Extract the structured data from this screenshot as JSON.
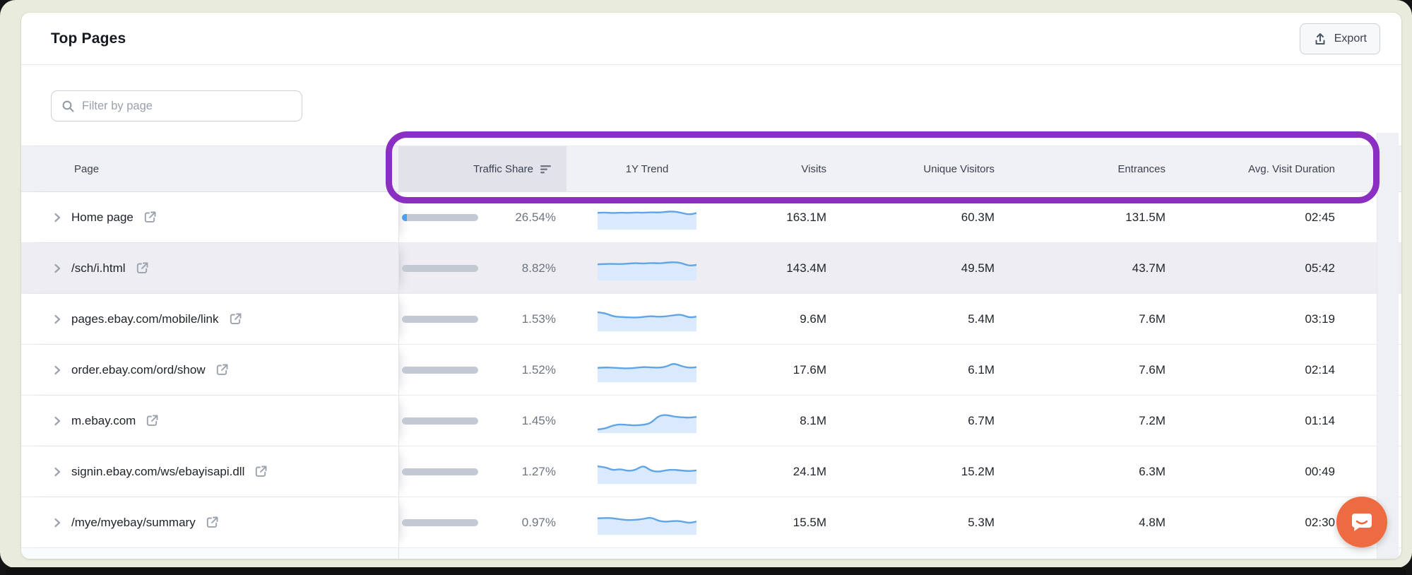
{
  "card": {
    "title": "Top Pages",
    "export_label": "Export",
    "filter_placeholder": "Filter by page"
  },
  "table": {
    "headers": {
      "page": "Page",
      "traffic_share": "Traffic Share",
      "trend": "1Y Trend",
      "visits": "Visits",
      "unique_visitors": "Unique Visitors",
      "entrances": "Entrances",
      "avg_visit_duration": "Avg. Visit Duration"
    },
    "sorted_column": "Traffic Share",
    "rows": [
      {
        "page": "Home page",
        "traffic_share": "26.54%",
        "share_value": 26.54,
        "visits": "163.1M",
        "unique_visitors": "60.3M",
        "entrances": "131.5M",
        "avg_visit_duration": "02:45",
        "highlighted": false,
        "trend": [
          0.8,
          0.82,
          0.78,
          0.81,
          0.79,
          0.82,
          0.8,
          0.83,
          0.81,
          0.85,
          0.88,
          0.8,
          0.7,
          0.78
        ]
      },
      {
        "page": "/sch/i.html",
        "traffic_share": "8.82%",
        "share_value": 8.82,
        "visits": "143.4M",
        "unique_visitors": "49.5M",
        "entrances": "43.7M",
        "avg_visit_duration": "05:42",
        "highlighted": true,
        "trend": [
          0.76,
          0.78,
          0.79,
          0.77,
          0.8,
          0.83,
          0.8,
          0.84,
          0.81,
          0.85,
          0.88,
          0.84,
          0.68,
          0.73
        ]
      },
      {
        "page": "pages.ebay.com/mobile/link",
        "traffic_share": "1.53%",
        "share_value": 1.53,
        "visits": "9.6M",
        "unique_visitors": "5.4M",
        "entrances": "7.6M",
        "avg_visit_duration": "03:19",
        "highlighted": false,
        "trend": [
          0.92,
          0.88,
          0.7,
          0.66,
          0.65,
          0.63,
          0.66,
          0.72,
          0.67,
          0.7,
          0.76,
          0.8,
          0.63,
          0.68
        ]
      },
      {
        "page": "order.ebay.com/ord/show",
        "traffic_share": "1.52%",
        "share_value": 1.52,
        "visits": "17.6M",
        "unique_visitors": "6.1M",
        "entrances": "7.6M",
        "avg_visit_duration": "02:14",
        "highlighted": false,
        "trend": [
          0.66,
          0.69,
          0.67,
          0.65,
          0.63,
          0.66,
          0.71,
          0.69,
          0.67,
          0.72,
          0.92,
          0.76,
          0.66,
          0.7
        ]
      },
      {
        "page": "m.ebay.com",
        "traffic_share": "1.45%",
        "share_value": 1.45,
        "visits": "8.1M",
        "unique_visitors": "6.7M",
        "entrances": "7.2M",
        "avg_visit_duration": "01:14",
        "highlighted": false,
        "trend": [
          0.08,
          0.12,
          0.3,
          0.36,
          0.32,
          0.3,
          0.33,
          0.42,
          0.82,
          0.88,
          0.78,
          0.74,
          0.72,
          0.76
        ]
      },
      {
        "page": "signin.ebay.com/ws/ebayisapi.dll",
        "traffic_share": "1.27%",
        "share_value": 1.27,
        "visits": "24.1M",
        "unique_visitors": "15.2M",
        "entrances": "6.3M",
        "avg_visit_duration": "00:49",
        "highlighted": false,
        "trend": [
          0.84,
          0.8,
          0.62,
          0.7,
          0.58,
          0.64,
          0.9,
          0.6,
          0.54,
          0.63,
          0.66,
          0.61,
          0.58,
          0.62
        ]
      },
      {
        "page": "/mye/myebay/summary",
        "traffic_share": "0.97%",
        "share_value": 0.97,
        "visits": "15.5M",
        "unique_visitors": "5.3M",
        "entrances": "4.8M",
        "avg_visit_duration": "02:30",
        "highlighted": false,
        "trend": [
          0.78,
          0.8,
          0.79,
          0.72,
          0.68,
          0.7,
          0.74,
          0.84,
          0.64,
          0.58,
          0.64,
          0.62,
          0.52,
          0.6
        ]
      }
    ]
  },
  "icons": {
    "export": "upload-arrow-tray",
    "search": "magnifier",
    "sort": "sort-descending-lines",
    "expand": "chevron-right",
    "external_link": "box-with-arrow",
    "chat": "speech-bubble-smile"
  },
  "colors": {
    "annotation_purple": "#8b2fc2",
    "bar_blue": "#4aa0f0",
    "bar_gray": "#c3c9d3",
    "sparkline_line": "#5fa5e8",
    "sparkline_fill": "#daeafc",
    "chat_orange": "#ee6b41",
    "page_background": "#e9ebdc"
  }
}
